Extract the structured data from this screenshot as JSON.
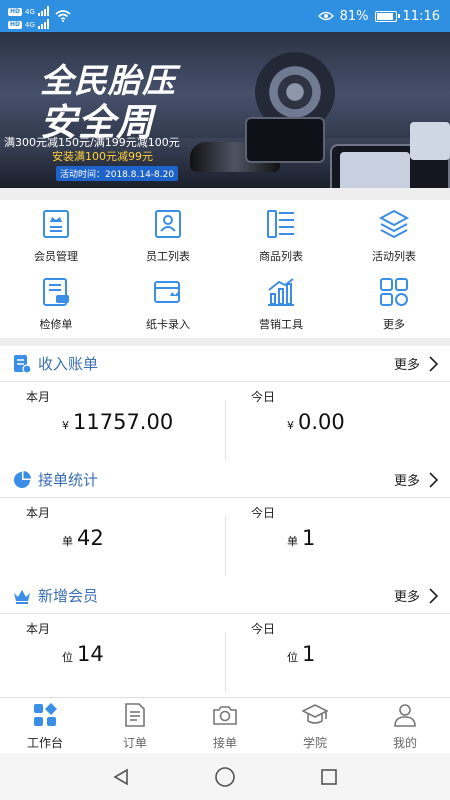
{
  "status_bar": {
    "net1": "4G",
    "net2": "4G",
    "battery_percent": "81%",
    "battery_level": 0.81,
    "time": "11:16"
  },
  "banner": {
    "title_line1": "全民胎压",
    "title_line2": "安全周",
    "promo1": "满300元减150元/满199元减100元",
    "promo2": "安装满100元减99元",
    "date": "活动时间：2018.8.14-8.20"
  },
  "menu": {
    "items": [
      {
        "label": "会员管理",
        "icon": "member-icon"
      },
      {
        "label": "员工列表",
        "icon": "staff-icon"
      },
      {
        "label": "商品列表",
        "icon": "goods-icon"
      },
      {
        "label": "活动列表",
        "icon": "activity-icon"
      },
      {
        "label": "检修单",
        "icon": "repair-icon"
      },
      {
        "label": "纸卡录入",
        "icon": "card-icon"
      },
      {
        "label": "营销工具",
        "icon": "marketing-icon"
      },
      {
        "label": "更多",
        "icon": "more-grid-icon"
      }
    ]
  },
  "income": {
    "title": "收入账单",
    "more": "更多",
    "month_label": "本月",
    "month_unit": "¥",
    "month_value": "11757.00",
    "today_label": "今日",
    "today_unit": "¥",
    "today_value": "0.00"
  },
  "orders": {
    "title": "接单统计",
    "more": "更多",
    "month_label": "本月",
    "month_unit": "单",
    "month_value": "42",
    "today_label": "今日",
    "today_unit": "单",
    "today_value": "1"
  },
  "members": {
    "title": "新增会员",
    "more": "更多",
    "month_label": "本月",
    "month_unit": "位",
    "month_value": "14",
    "today_label": "今日",
    "today_unit": "位",
    "today_value": "1"
  },
  "bottom_nav": {
    "items": [
      {
        "label": "工作台",
        "icon": "workbench-icon"
      },
      {
        "label": "订单",
        "icon": "order-icon"
      },
      {
        "label": "接单",
        "icon": "camera-icon"
      },
      {
        "label": "学院",
        "icon": "academy-icon"
      },
      {
        "label": "我的",
        "icon": "profile-icon"
      }
    ]
  },
  "colors": {
    "status_bar": "#2f8fe0",
    "accent": "#3a8ee6",
    "title_blue": "#3a6fb5"
  }
}
